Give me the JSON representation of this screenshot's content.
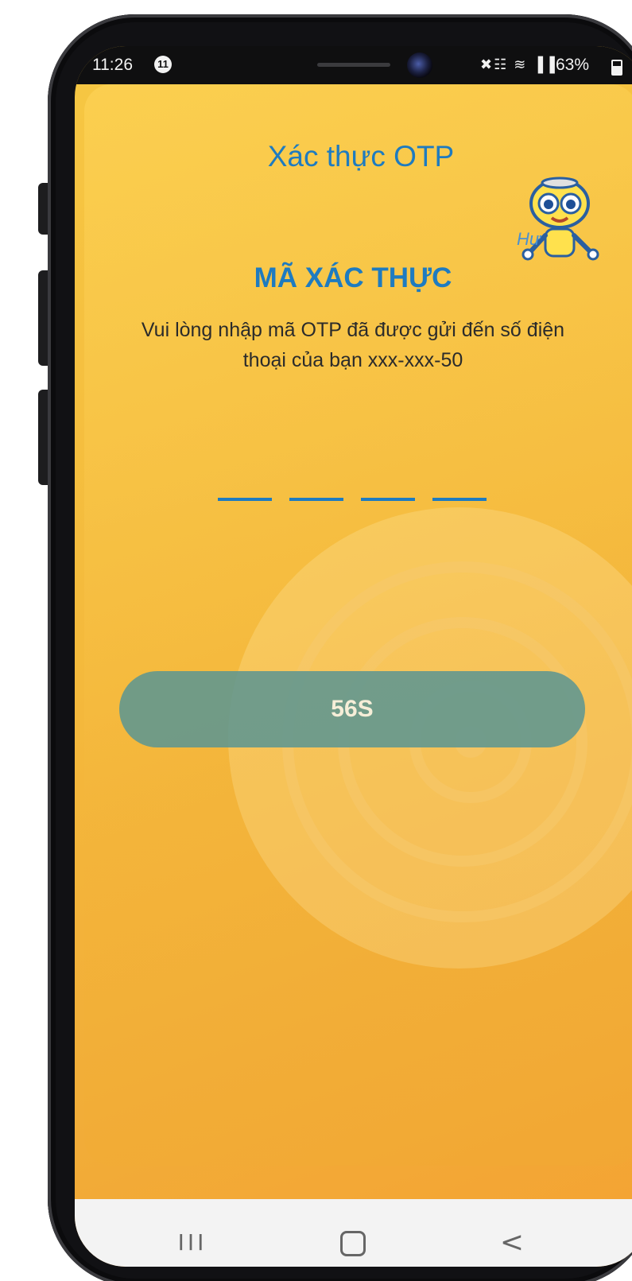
{
  "status_bar": {
    "time": "11:26",
    "notification_count": "11",
    "signal_icons": "✖☷ ≋ ▐▐",
    "battery": "63%"
  },
  "screen": {
    "title": "Xác thực OTP",
    "heading": "MÃ XÁC THỰC",
    "description": "Vui lòng nhập mã OTP đã được gửi đến số điện thoại của bạn xxx-xxx-50",
    "otp_slots": 4,
    "timer_button_label": "56S",
    "mascot_hint": "Hư"
  },
  "nav_bar": {
    "recents_label": "III",
    "back_label": "<"
  },
  "colors": {
    "background": "#f4b93c",
    "accent": "#1e7bc0",
    "button": "#5f9691",
    "button_text": "#f6eed8"
  }
}
